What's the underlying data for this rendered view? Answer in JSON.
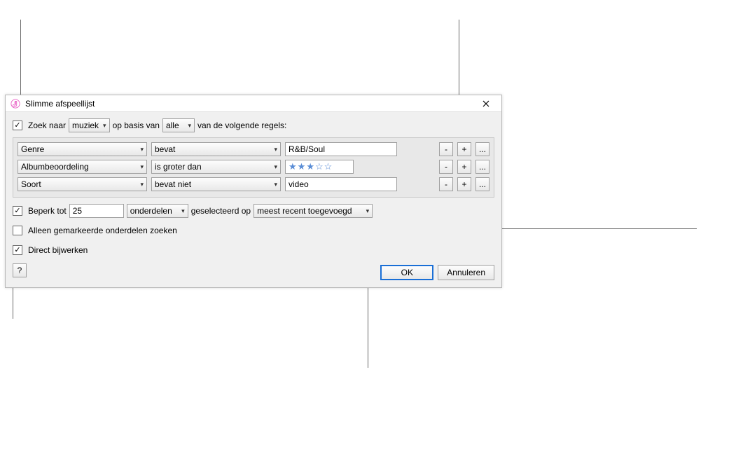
{
  "dialog": {
    "title": "Slimme afspeellijst",
    "icon_char": "♫",
    "icon_color": "#e85bc3"
  },
  "match": {
    "checked": true,
    "label_prefix": "Zoek naar",
    "media": "muziek",
    "label_mid": "op basis van",
    "scope": "alle",
    "label_suffix": "van de volgende regels:"
  },
  "rules": [
    {
      "field": "Genre",
      "op": "bevat",
      "value_type": "text",
      "value": "R&B/Soul"
    },
    {
      "field": "Albumbeoordeling",
      "op": "is groter dan",
      "value_type": "stars",
      "stars": 3
    },
    {
      "field": "Soort",
      "op": "bevat niet",
      "value_type": "text",
      "value": "video"
    }
  ],
  "rule_buttons": {
    "minus": "-",
    "plus": "+",
    "more": "..."
  },
  "limit": {
    "checked": true,
    "label": "Beperk tot",
    "value": "25",
    "unit": "onderdelen",
    "label_mid": "geselecteerd op",
    "sort": "meest recent toegevoegd"
  },
  "only_checked": {
    "checked": false,
    "label": "Alleen gemarkeerde onderdelen zoeken"
  },
  "live_update": {
    "checked": true,
    "label": "Direct bijwerken"
  },
  "help": "?",
  "buttons": {
    "ok": "OK",
    "cancel": "Annuleren"
  }
}
